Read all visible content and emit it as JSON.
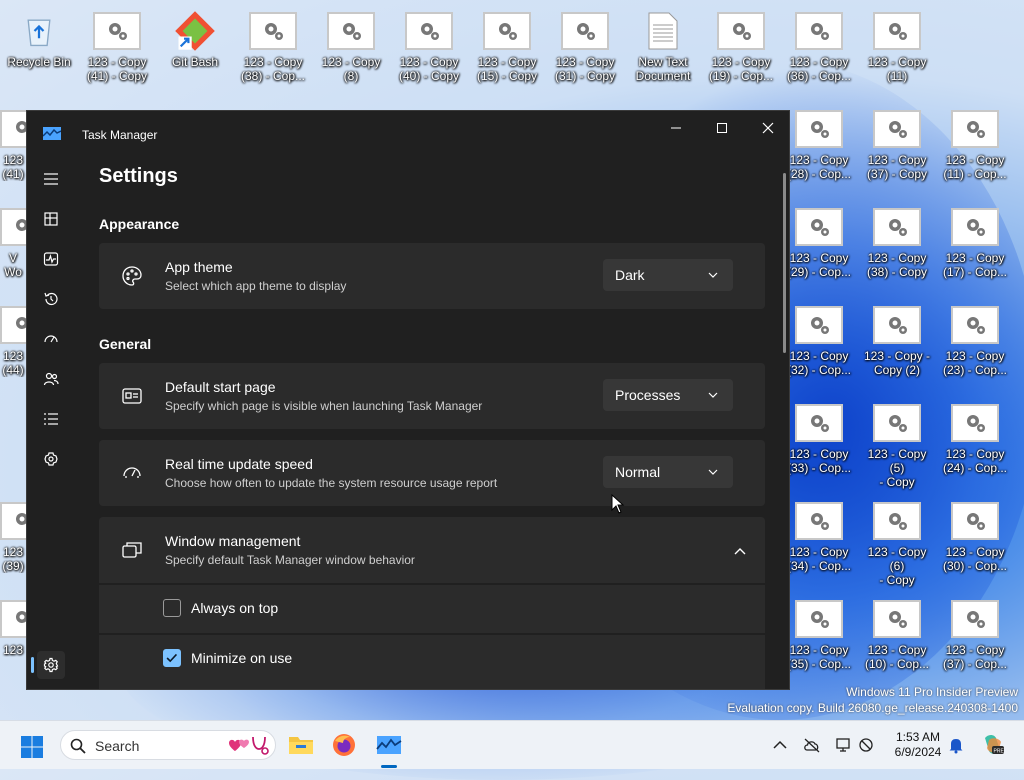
{
  "desktop": {
    "icons_top": [
      {
        "label": "Recycle Bin",
        "type": "bin"
      },
      {
        "label": "123 - Copy\n(41) - Copy",
        "type": "file"
      },
      {
        "label": "Git Bash",
        "type": "git"
      },
      {
        "label": "123 - Copy\n(38) - Cop...",
        "type": "file"
      },
      {
        "label": "123 - Copy (8)",
        "type": "file"
      },
      {
        "label": "123 - Copy\n(40) - Copy",
        "type": "file"
      },
      {
        "label": "123 - Copy\n(15) - Copy",
        "type": "file"
      },
      {
        "label": "123 - Copy\n(31) - Copy",
        "type": "file"
      },
      {
        "label": "New Text\nDocument",
        "type": "txt"
      },
      {
        "label": "123 - Copy\n(19) - Cop...",
        "type": "file"
      },
      {
        "label": "123 - Copy\n(36) - Cop...",
        "type": "file"
      },
      {
        "label": "123 - Copy\n(11)",
        "type": "file"
      }
    ],
    "icons_right_col1": [
      "123 - Copy\n(28) - Cop...",
      "123 - Copy\n(29) - Cop...",
      "123 - Copy\n(32) - Cop...",
      "123 - Copy\n(33) - Cop...",
      "123 - Copy\n(34) - Cop...",
      "123 - Copy\n(35) - Cop..."
    ],
    "icons_right_col2": [
      "123 - Copy\n(37) - Copy",
      "123 - Copy\n(38) - Copy",
      "123 - Copy -\nCopy (2)",
      "123 - Copy (5)\n- Copy",
      "123 - Copy (6)\n- Copy",
      "123 - Copy\n(10) - Cop..."
    ],
    "icons_right_col3": [
      "123 - Copy\n(11) - Cop...",
      "123 - Copy\n(17) - Cop...",
      "123 - Copy\n(23) - Cop...",
      "123 - Copy\n(24) - Cop...",
      "123 - Copy\n(30) - Cop...",
      "123 - Copy\n(37) - Cop..."
    ],
    "icons_left_partial": [
      "123\n(41)",
      "V\nWo",
      "123\n(44)",
      "123\n(39)",
      "123"
    ],
    "watermark_line1": "Windows 11 Pro Insider Preview",
    "watermark_line2": "Evaluation copy. Build 26080.ge_release.240308-1400"
  },
  "window": {
    "title": "Task Manager",
    "minimize": "—",
    "maximize": "☐",
    "close": "✕"
  },
  "settings": {
    "page_title": "Settings",
    "appearance_header": "Appearance",
    "general_header": "General",
    "app_theme": {
      "title": "App theme",
      "desc": "Select which app theme to display",
      "value": "Dark"
    },
    "default_start_page": {
      "title": "Default start page",
      "desc": "Specify which page is visible when launching Task Manager",
      "value": "Processes"
    },
    "update_speed": {
      "title": "Real time update speed",
      "desc": "Choose how often to update the system resource usage report",
      "value": "Normal"
    },
    "window_management": {
      "title": "Window management",
      "desc": "Specify default Task Manager window behavior"
    },
    "always_on_top": {
      "label": "Always on top",
      "checked": false
    },
    "minimize_on_use": {
      "label": "Minimize on use",
      "checked": true
    }
  },
  "nav_icons": [
    "hamburger-icon",
    "processes-icon",
    "performance-icon",
    "app-history-icon",
    "startup-apps-icon",
    "users-icon",
    "details-icon",
    "services-icon",
    "settings-icon"
  ],
  "taskbar": {
    "search_placeholder": "Search",
    "time": "1:53 AM",
    "date": "6/9/2024"
  },
  "colors": {
    "accent": "#7cc2ff",
    "window_bg": "#202020",
    "card_bg": "#2b2b2b",
    "taskbar_bg": "#eef2f7"
  }
}
